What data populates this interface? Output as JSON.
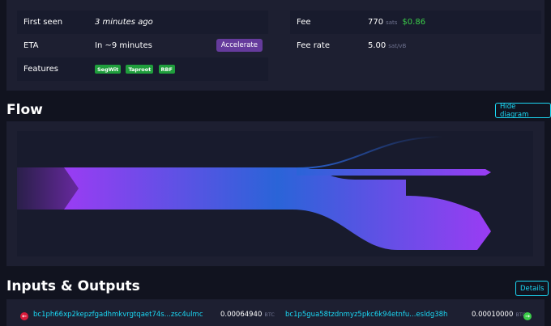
{
  "details": {
    "left": [
      {
        "label": "First seen",
        "value": "3 minutes ago"
      },
      {
        "label": "ETA",
        "value": "In ~9 minutes",
        "button": "Accelerate"
      },
      {
        "label": "Features",
        "badges": [
          "SegWit",
          "Taproot",
          "RBF"
        ]
      }
    ],
    "right": [
      {
        "label": "Fee",
        "value": "770",
        "unit": "sats",
        "fiat": "$0.86"
      },
      {
        "label": "Fee rate",
        "value": "5.00",
        "unit": "sat/vB"
      }
    ]
  },
  "flow": {
    "title": "Flow",
    "toggle_label": "Hide diagram"
  },
  "io": {
    "title": "Inputs & Outputs",
    "details_label": "Details",
    "input": {
      "address": "bc1ph66xp2kepzfgadhmkvrgtqaet74s...zsc4ulmc",
      "amount": "0.00064940",
      "unit": "BTC"
    },
    "output": {
      "address": "bc1p5gua58tzdnmyz5pkc6k94etnfu...esldg38h",
      "amount": "0.00010000",
      "unit": "BTC"
    }
  },
  "colors": {
    "accent": "#1bd8f4",
    "purple": "#653b9c",
    "green": "#3bcc49",
    "badge": "#1f9e3c",
    "input_red": "#d81b3b"
  }
}
